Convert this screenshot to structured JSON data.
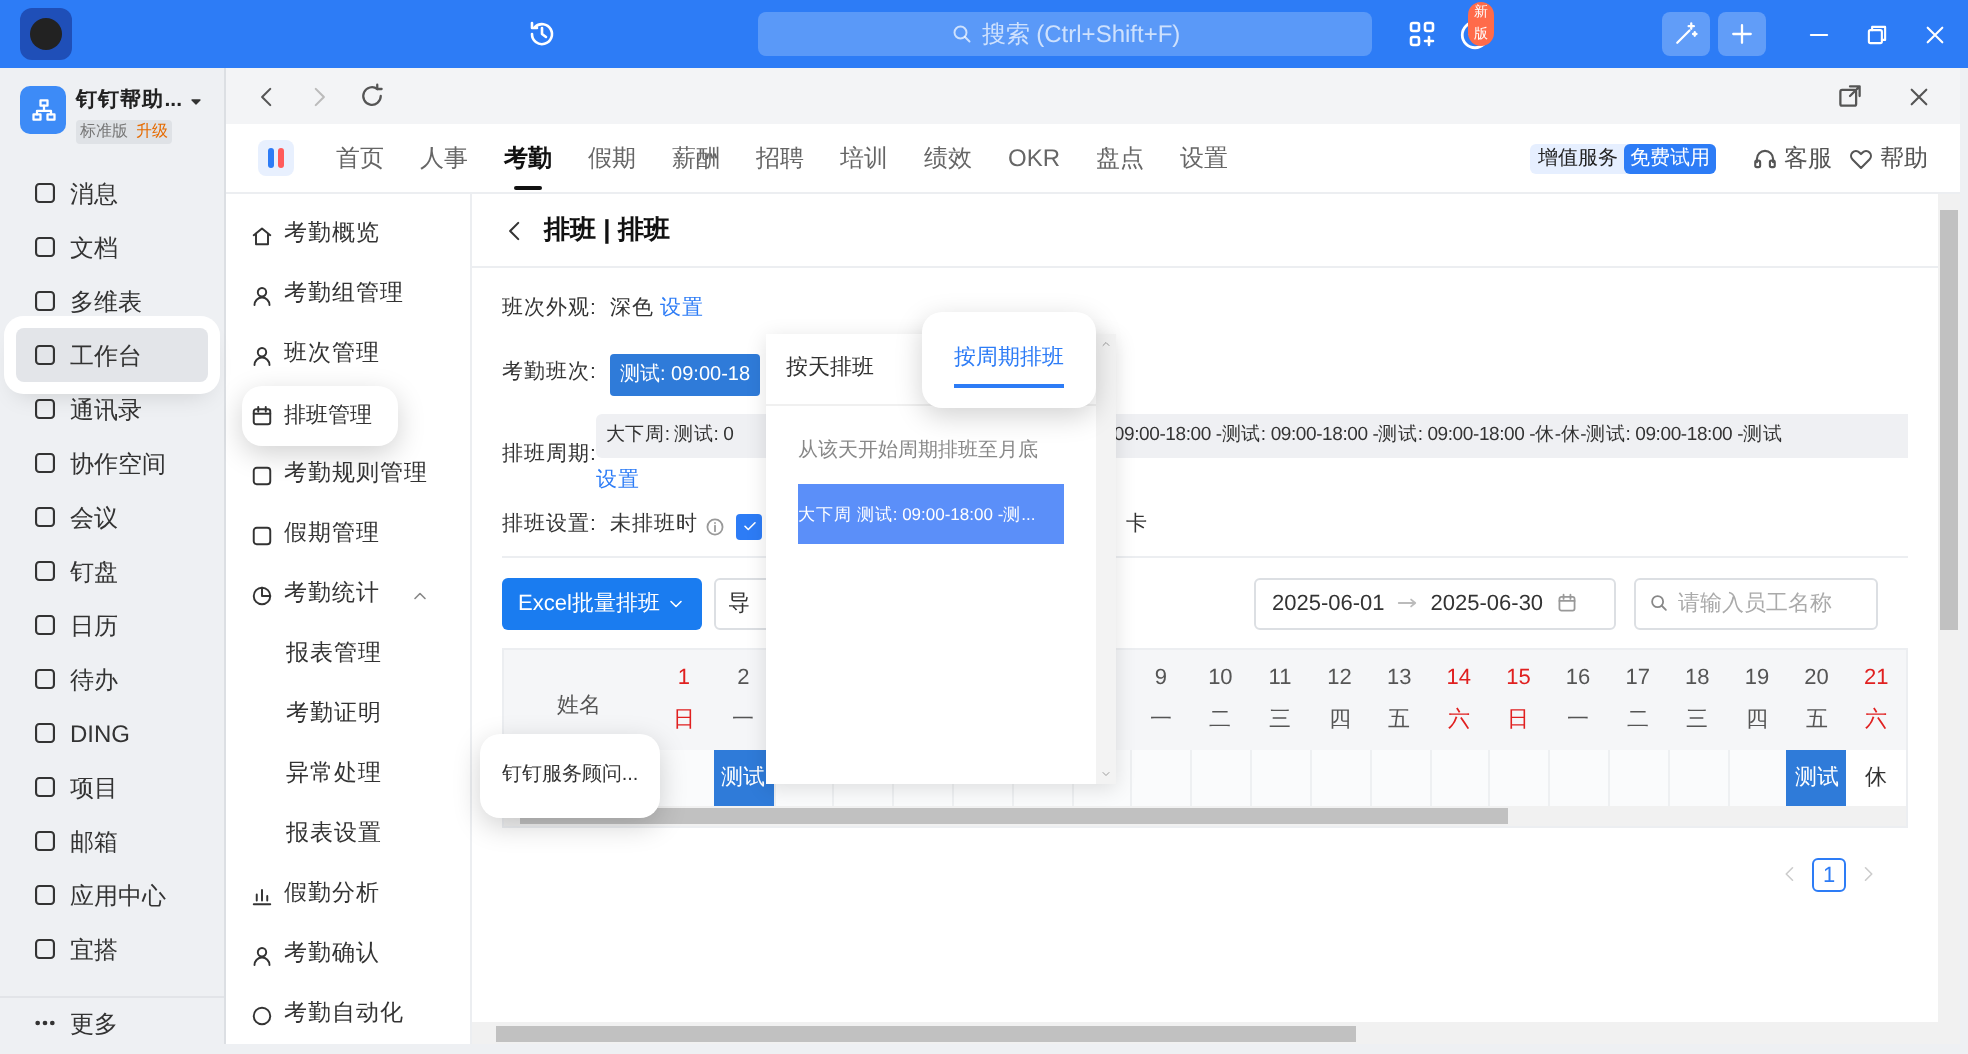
{
  "topbar": {
    "search_placeholder": "搜索 (Ctrl+Shift+F)",
    "update_badge": "新版"
  },
  "org": {
    "name": "钉钉帮助...",
    "edition": "标准版",
    "upgrade": "升级"
  },
  "sidebar": {
    "items": [
      {
        "label": "消息",
        "selected": false
      },
      {
        "label": "文档",
        "selected": false
      },
      {
        "label": "多维表",
        "selected": false
      },
      {
        "label": "工作台",
        "selected": true
      },
      {
        "label": "通讯录",
        "selected": false
      },
      {
        "label": "协作空间",
        "selected": false
      },
      {
        "label": "会议",
        "selected": false
      },
      {
        "label": "钉盘",
        "selected": false
      },
      {
        "label": "日历",
        "selected": false
      },
      {
        "label": "待办",
        "selected": false
      },
      {
        "label": "DING",
        "selected": false
      },
      {
        "label": "项目",
        "selected": false
      },
      {
        "label": "邮箱",
        "selected": false
      },
      {
        "label": "应用中心",
        "selected": false
      },
      {
        "label": "宜搭",
        "selected": false
      }
    ],
    "more": "更多"
  },
  "app_tabs": [
    {
      "label": "首页",
      "selected": false
    },
    {
      "label": "人事",
      "selected": false
    },
    {
      "label": "考勤",
      "selected": true
    },
    {
      "label": "假期",
      "selected": false
    },
    {
      "label": "薪酬",
      "selected": false
    },
    {
      "label": "招聘",
      "selected": false
    },
    {
      "label": "培训",
      "selected": false
    },
    {
      "label": "绩效",
      "selected": false
    },
    {
      "label": "OKR",
      "selected": false
    },
    {
      "label": "盘点",
      "selected": false
    },
    {
      "label": "设置",
      "selected": false
    }
  ],
  "header_actions": {
    "service_label": "增值服务",
    "trial_badge": "免费试用",
    "support": "客服",
    "help": "帮助"
  },
  "submenu": [
    {
      "label": "考勤概览",
      "selected": false
    },
    {
      "label": "考勤组管理",
      "selected": false
    },
    {
      "label": "班次管理",
      "selected": false
    },
    {
      "label": "排班管理",
      "selected": true
    },
    {
      "label": "考勤规则管理",
      "selected": false
    },
    {
      "label": "假期管理",
      "selected": false
    },
    {
      "label": "考勤统计",
      "selected": false,
      "expanded": true,
      "children": [
        {
          "label": "报表管理",
          "selected": false
        },
        {
          "label": "考勤证明",
          "selected": false
        },
        {
          "label": "异常处理",
          "selected": false
        },
        {
          "label": "报表设置",
          "selected": false
        }
      ]
    },
    {
      "label": "假勤分析",
      "selected": false
    },
    {
      "label": "考勤确认",
      "selected": false
    },
    {
      "label": "考勤自动化",
      "selected": false
    }
  ],
  "page_title": "排班 | 排班",
  "form": {
    "appearance": {
      "label": "班次外观:",
      "value": "深色",
      "link": "设置"
    },
    "shift": {
      "label": "考勤班次:",
      "tag": "测试: 09:00-18"
    },
    "cycle": {
      "label": "排班周期:",
      "value_start": "大下周: 测试: 0",
      "value_end": "09:00-18:00 -测试: 09:00-18:00 -测试: 09:00-18:00 -休-休-测试: 09:00-18:00 -测试",
      "link": "设置"
    },
    "settings": {
      "label": "排班设置:",
      "text": "未排班时",
      "checked": true,
      "text_end": "卡"
    }
  },
  "toolbar": {
    "excel_button": "Excel批量排班",
    "export_button": "导",
    "date_start": "2025-06-01",
    "date_end": "2025-06-30",
    "search_placeholder": "请输入员工名称"
  },
  "table": {
    "name_header": "姓名",
    "days": [
      {
        "date": "1",
        "weekday": "日",
        "weekend": true
      },
      {
        "date": "2",
        "weekday": "一",
        "weekend": false
      },
      {
        "date": "9",
        "weekday": "一",
        "weekend": false
      },
      {
        "date": "10",
        "weekday": "二",
        "weekend": false
      },
      {
        "date": "11",
        "weekday": "三",
        "weekend": false
      },
      {
        "date": "12",
        "weekday": "四",
        "weekend": false
      },
      {
        "date": "13",
        "weekday": "五",
        "weekend": false
      },
      {
        "date": "14",
        "weekday": "六",
        "weekend": true
      },
      {
        "date": "15",
        "weekday": "日",
        "weekend": true
      },
      {
        "date": "16",
        "weekday": "一",
        "weekend": false
      },
      {
        "date": "17",
        "weekday": "二",
        "weekend": false
      },
      {
        "date": "18",
        "weekday": "三",
        "weekend": false
      },
      {
        "date": "19",
        "weekday": "四",
        "weekend": false
      },
      {
        "date": "20",
        "weekday": "五",
        "weekend": false
      },
      {
        "date": "21",
        "weekday": "六",
        "weekend": true
      }
    ],
    "rows": [
      {
        "name": "钉钉服务顾问...",
        "cells": [
          {
            "kind": "empty"
          },
          {
            "kind": "shift",
            "text": "测试"
          },
          {
            "kind": "empty"
          },
          {
            "kind": "empty"
          },
          {
            "kind": "empty"
          },
          {
            "kind": "empty"
          },
          {
            "kind": "empty"
          },
          {
            "kind": "empty"
          },
          {
            "kind": "empty"
          },
          {
            "kind": "empty"
          },
          {
            "kind": "empty"
          },
          {
            "kind": "empty"
          },
          {
            "kind": "empty"
          },
          {
            "kind": "empty"
          },
          {
            "kind": "empty"
          },
          {
            "kind": "empty"
          },
          {
            "kind": "empty"
          },
          {
            "kind": "empty"
          },
          {
            "kind": "empty"
          },
          {
            "kind": "shift",
            "text": "测试"
          },
          {
            "kind": "rest",
            "text": "休"
          }
        ]
      }
    ]
  },
  "pagination": {
    "pages": [
      {
        "label": "1",
        "selected": true
      }
    ]
  },
  "popup": {
    "tabs": [
      {
        "label": "按天排班",
        "selected": false
      },
      {
        "label": "按周期排班",
        "selected": true
      }
    ],
    "hint": "从该天开始周期排班至月底",
    "options": [
      {
        "label": "大下周 测试: 09:00-18:00 -测...",
        "selected": true
      }
    ]
  }
}
